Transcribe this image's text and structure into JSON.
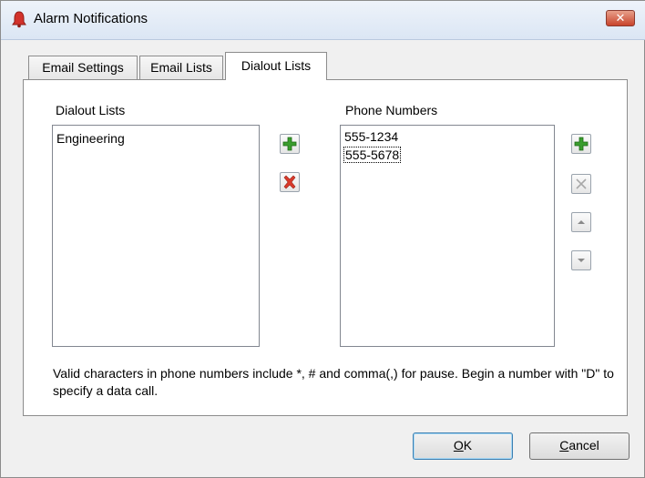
{
  "window": {
    "title": "Alarm Notifications",
    "close_glyph": "✕"
  },
  "tabs": [
    {
      "label": "Email Settings",
      "active": false
    },
    {
      "label": "Email Lists",
      "active": false
    },
    {
      "label": "Dialout Lists",
      "active": true
    }
  ],
  "dialout": {
    "label": "Dialout Lists",
    "items": [
      "Engineering"
    ]
  },
  "phones": {
    "label": "Phone Numbers",
    "items": [
      "555-1234",
      "555-5678"
    ]
  },
  "icons": {
    "add": "plus-icon",
    "delete": "delete-x-icon",
    "up": "up-arrow-icon",
    "down": "down-arrow-icon",
    "add_color": "#3a9d2e",
    "delete_color": "#d93a2b"
  },
  "note": "Valid characters in phone numbers include *, # and comma(,) for pause. Begin a number with \"D\" to specify a data call.",
  "buttons": {
    "ok_mnemonic": "O",
    "ok_rest": "K",
    "cancel_mnemonic": "C",
    "cancel_rest": "ancel"
  }
}
